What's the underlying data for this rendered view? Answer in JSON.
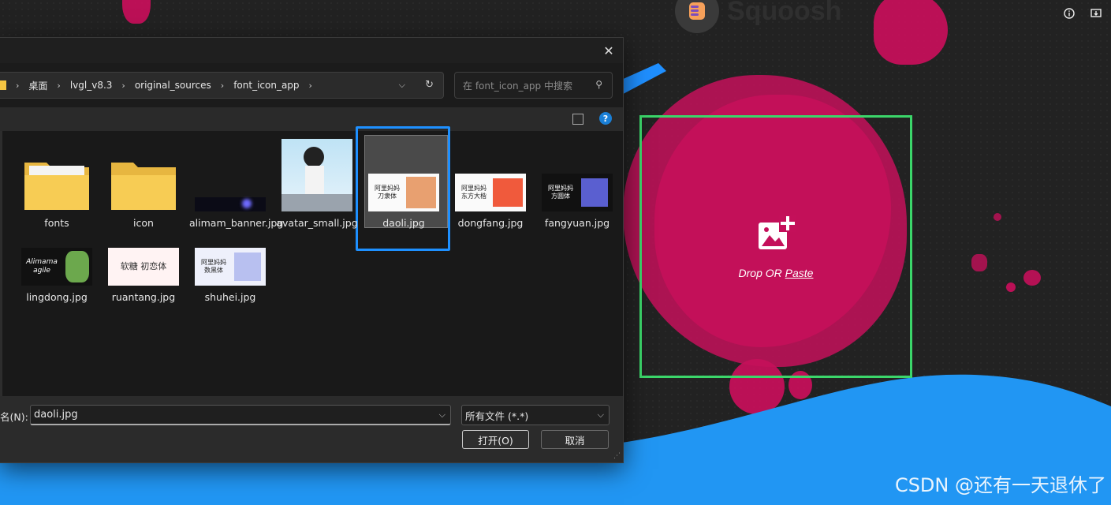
{
  "app": {
    "name": "Squoosh",
    "drop_text": "Drop OR",
    "paste_label": "Paste",
    "info_icon": "info-icon",
    "install_icon": "install-icon"
  },
  "colors": {
    "accent_pink": "#c4105a",
    "wave_blue": "#2196f3",
    "highlight_green": "#3bd66a",
    "selection_blue": "#1e90ff"
  },
  "watermark": "CSDN @还有一天退休了",
  "dialog": {
    "close_label": "✕",
    "breadcrumb": [
      "桌面",
      "lvgl_v8.3",
      "original_sources",
      "font_icon_app"
    ],
    "search_placeholder": "在 font_icon_app 中搜索",
    "files": [
      {
        "name": "fonts",
        "type": "folder"
      },
      {
        "name": "icon",
        "type": "folder"
      },
      {
        "name": "alimam_banner.jpg",
        "type": "image"
      },
      {
        "name": "avatar_small.jpg",
        "type": "image"
      },
      {
        "name": "daoli.jpg",
        "type": "image",
        "selected": true,
        "thumb_text": "阿里妈妈 刀隶体"
      },
      {
        "name": "dongfang.jpg",
        "type": "image",
        "thumb_text": "阿里妈妈 东方大楷"
      },
      {
        "name": "fangyuan.jpg",
        "type": "image",
        "thumb_text": "阿里妈妈 方圆体"
      },
      {
        "name": "lingdong.jpg",
        "type": "image",
        "thumb_text": "Alimama agile"
      },
      {
        "name": "ruantang.jpg",
        "type": "image",
        "thumb_text": "软糖 初恋体"
      },
      {
        "name": "shuhei.jpg",
        "type": "image",
        "thumb_text": "阿里妈妈 数黑体"
      }
    ],
    "filename_label": "名(N):",
    "filename_value": "daoli.jpg",
    "filetype_value": "所有文件 (*.*)",
    "open_label": "打开(O)",
    "cancel_label": "取消"
  }
}
